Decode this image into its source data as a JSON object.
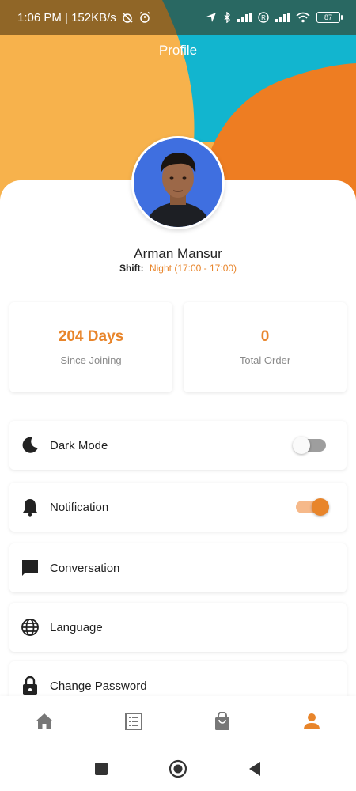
{
  "status_bar": {
    "time_speed": "1:06 PM | 152KB/s",
    "battery": "87"
  },
  "header": {
    "title": "Profile"
  },
  "profile": {
    "name": "Arman Mansur",
    "shift_label": "Shift:",
    "shift_value": "Night (17:00 - 17:00)"
  },
  "stats": [
    {
      "value": "204 Days",
      "label": "Since Joining"
    },
    {
      "value": "0",
      "label": "Total Order"
    }
  ],
  "menu": {
    "dark_mode": {
      "label": "Dark Mode",
      "icon": "moon-icon",
      "toggle": false
    },
    "notification": {
      "label": "Notification",
      "icon": "bell-icon",
      "toggle": true
    },
    "conversation": {
      "label": "Conversation",
      "icon": "chat-icon"
    },
    "language": {
      "label": "Language",
      "icon": "globe-icon"
    },
    "change_password": {
      "label": "Change Password",
      "icon": "lock-icon"
    }
  },
  "bottom_nav": {
    "items": [
      "home-icon",
      "list-icon",
      "bag-icon",
      "person-icon"
    ],
    "active": "person-icon"
  },
  "colors": {
    "accent": "#e8852b",
    "header_yellow": "#f7b24c",
    "header_teal": "#12b5cf",
    "header_orange": "#ee7d22"
  }
}
